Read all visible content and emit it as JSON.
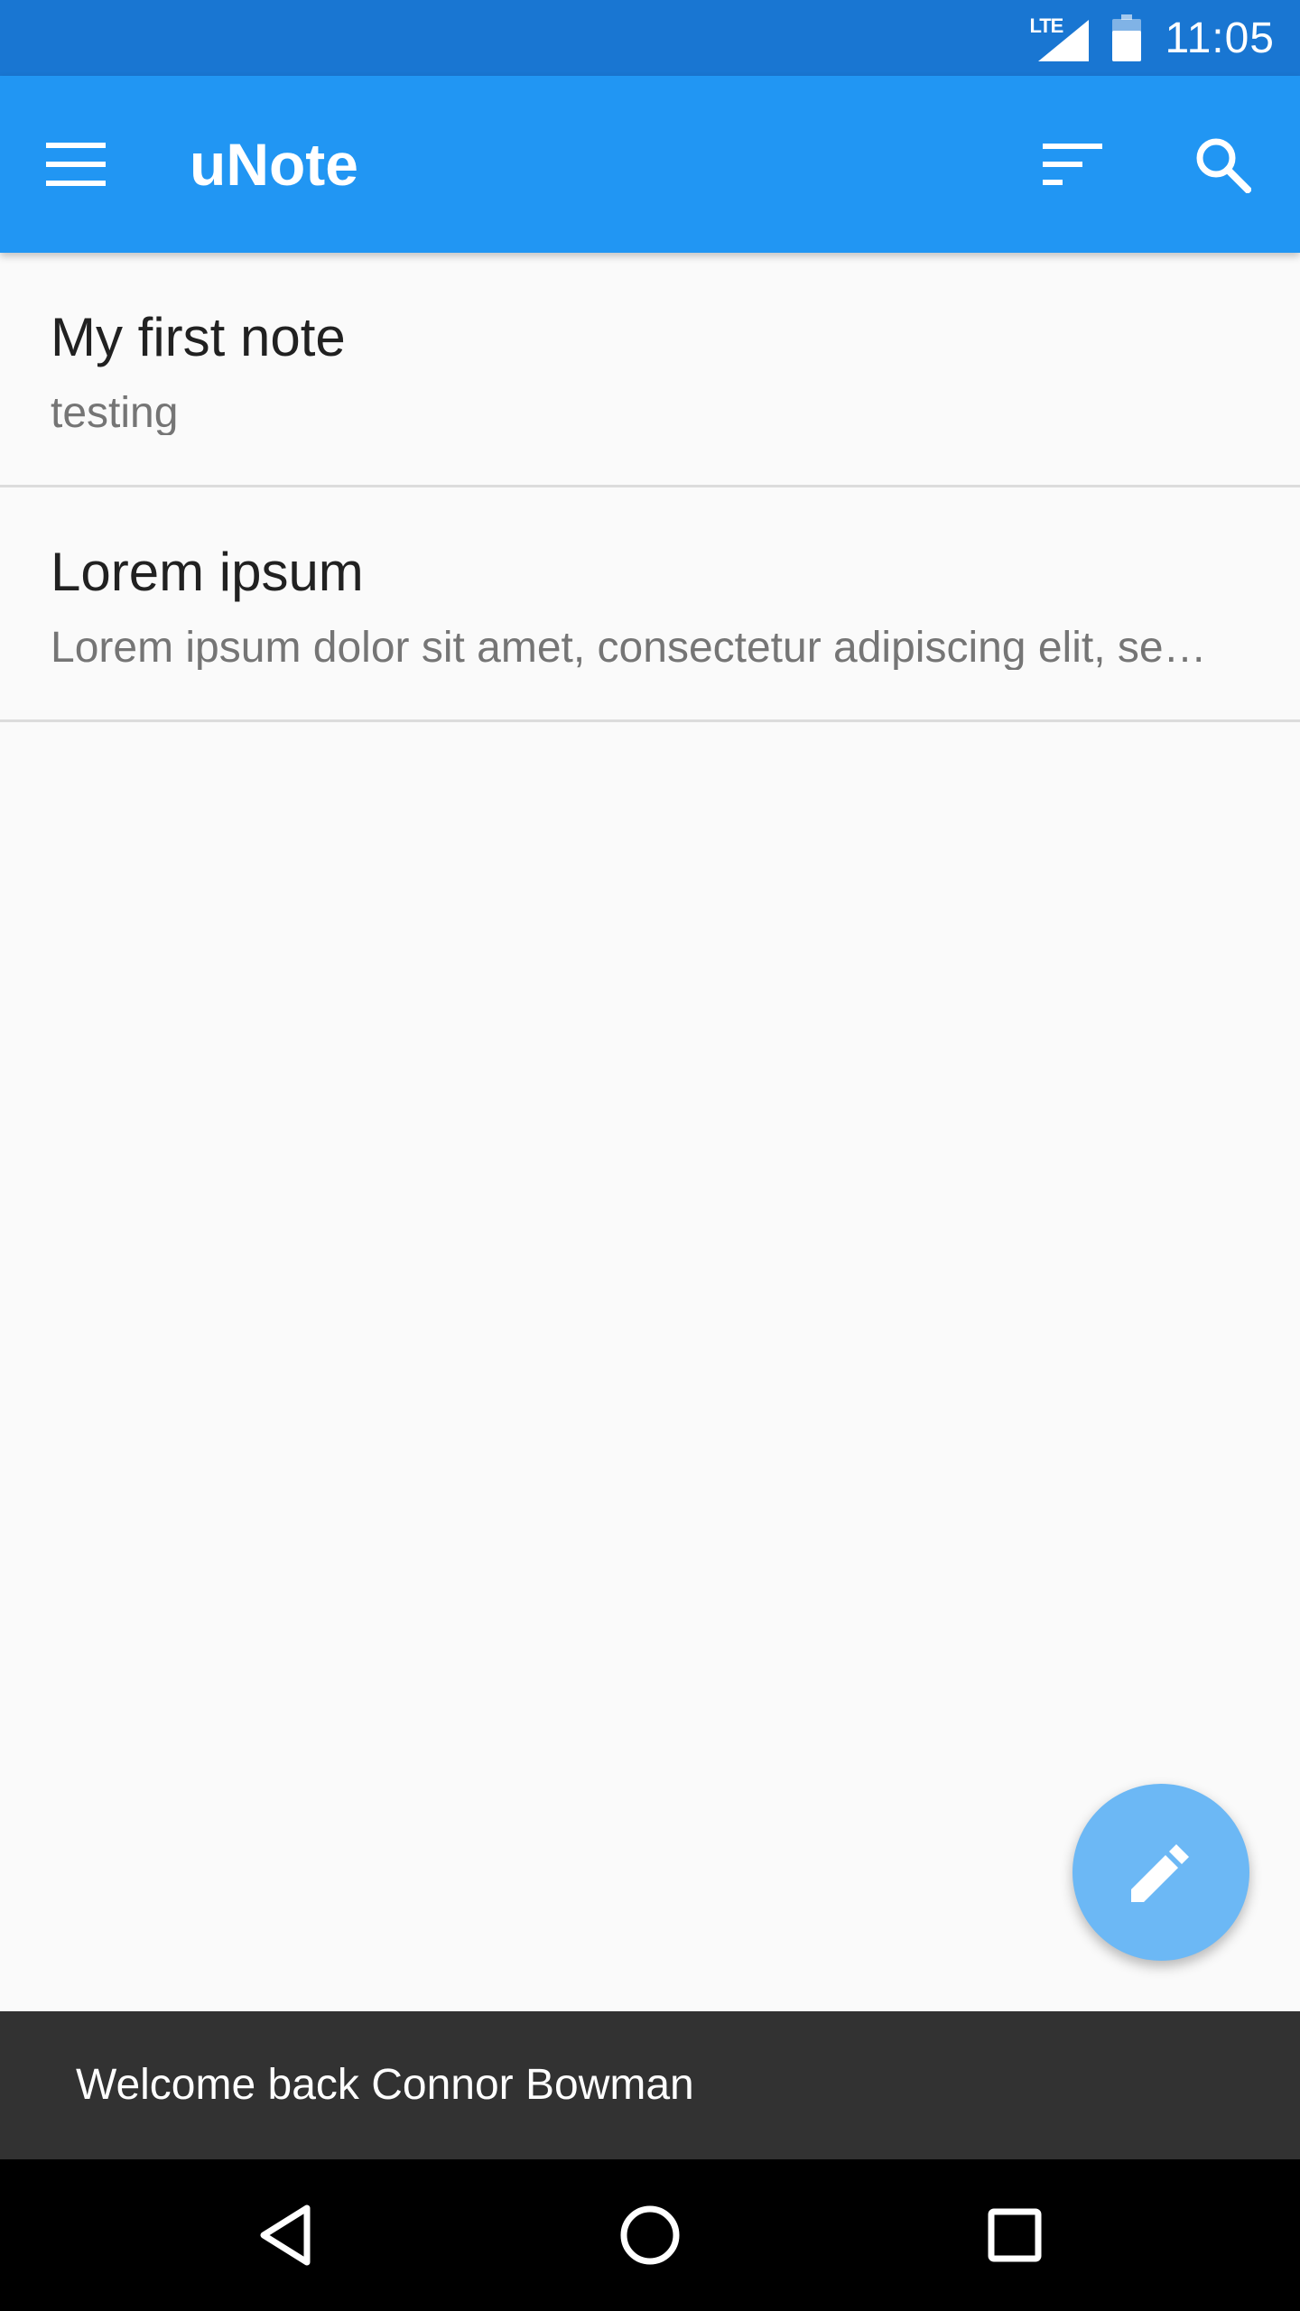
{
  "status_bar": {
    "network": "LTE",
    "time": "11:05",
    "icons": [
      "lte-signal-icon",
      "battery-icon"
    ]
  },
  "app_bar": {
    "title": "uNote",
    "icons": [
      "menu-icon",
      "sort-icon",
      "search-icon"
    ],
    "color": "#2196f3"
  },
  "notes": [
    {
      "title": "My first note",
      "preview": "testing"
    },
    {
      "title": "Lorem ipsum",
      "preview": "Lorem ipsum dolor sit amet, consectetur adipiscing elit, se…"
    }
  ],
  "fab": {
    "icon": "pencil-icon",
    "color": "#6cb8f5"
  },
  "snackbar": {
    "message": "Welcome back Connor Bowman"
  },
  "nav_bar": {
    "icons": [
      "back-icon",
      "home-icon",
      "recent-apps-icon"
    ]
  },
  "colors": {
    "primary": "#2196f3",
    "primary_dark": "#1976d2",
    "background": "#fafafa",
    "snackbar": "#323232"
  }
}
